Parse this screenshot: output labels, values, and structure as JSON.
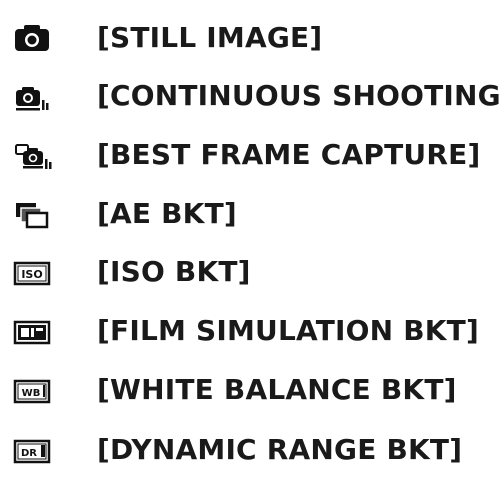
{
  "menu": {
    "items": [
      {
        "icon": "camera-icon",
        "label": "[STILL IMAGE]"
      },
      {
        "icon": "continuous-shooting-icon",
        "label": "[CONTINUOUS SHOOTING]"
      },
      {
        "icon": "best-frame-capture-icon",
        "label": "[BEST FRAME CAPTURE]"
      },
      {
        "icon": "ae-bracketing-icon",
        "label": "[AE BKT]"
      },
      {
        "icon": "iso-bracketing-icon",
        "label": "[ISO BKT]",
        "icon_text": "ISO"
      },
      {
        "icon": "film-simulation-bracketing-icon",
        "label": "[FILM SIMULATION BKT]"
      },
      {
        "icon": "white-balance-bracketing-icon",
        "label": "[WHITE BALANCE BKT]",
        "icon_text": "WB"
      },
      {
        "icon": "dynamic-range-bracketing-icon",
        "label": "[DYNAMIC RANGE BKT]",
        "icon_text": "DR"
      }
    ]
  }
}
